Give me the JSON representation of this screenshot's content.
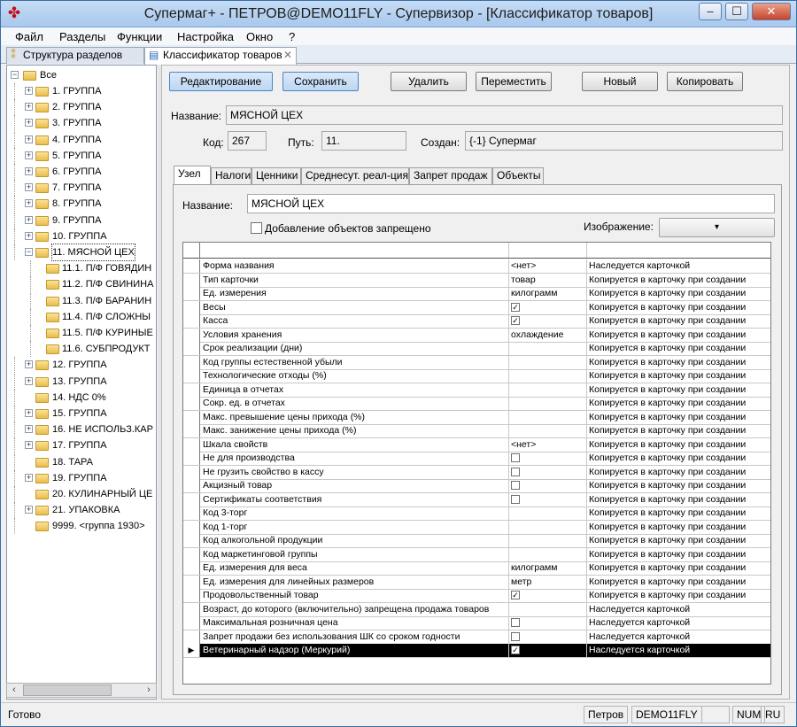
{
  "window": {
    "title": "Супермаг+ - ПЕТРОВ@DEMO11FLY - Супервизор  - [Классификатор товаров]",
    "buttons": {
      "minimize": "–",
      "maximize": "☐",
      "close": "✕"
    }
  },
  "menu": [
    "Файл",
    "Разделы",
    "Функции",
    "Настройка",
    "Окно",
    "?"
  ],
  "doc_tabs": [
    {
      "label": "Структура разделов",
      "active": false
    },
    {
      "label": "Классификатор товаров",
      "active": true
    }
  ],
  "tree": {
    "root": "Все",
    "items": [
      {
        "label": "1. ГРУППА",
        "level": 1,
        "expander": "+"
      },
      {
        "label": "2. ГРУППА",
        "level": 1,
        "expander": "+"
      },
      {
        "label": "3. ГРУППА",
        "level": 1,
        "expander": "+"
      },
      {
        "label": "4. ГРУППА",
        "level": 1,
        "expander": "+"
      },
      {
        "label": "5. ГРУППА",
        "level": 1,
        "expander": "+"
      },
      {
        "label": "6. ГРУППА",
        "level": 1,
        "expander": "+"
      },
      {
        "label": "7. ГРУППА",
        "level": 1,
        "expander": "+"
      },
      {
        "label": "8. ГРУППА",
        "level": 1,
        "expander": "+"
      },
      {
        "label": "9. ГРУППА",
        "level": 1,
        "expander": "+"
      },
      {
        "label": "10. ГРУППА",
        "level": 1,
        "expander": "+"
      },
      {
        "label": "11. МЯСНОЙ ЦЕХ",
        "level": 1,
        "expander": "−",
        "selected": true
      },
      {
        "label": "11.1. П/Ф ГОВЯДИН",
        "level": 2,
        "expander": ""
      },
      {
        "label": "11.2. П/Ф СВИНИНА",
        "level": 2,
        "expander": ""
      },
      {
        "label": "11.3. П/Ф БАРАНИН",
        "level": 2,
        "expander": ""
      },
      {
        "label": "11.4. П/Ф СЛОЖНЫ",
        "level": 2,
        "expander": ""
      },
      {
        "label": "11.5. П/Ф КУРИНЫЕ",
        "level": 2,
        "expander": ""
      },
      {
        "label": "11.6. СУБПРОДУКТ",
        "level": 2,
        "expander": ""
      },
      {
        "label": "12. ГРУППА",
        "level": 1,
        "expander": "+"
      },
      {
        "label": "13. ГРУППА",
        "level": 1,
        "expander": "+"
      },
      {
        "label": "14. НДС 0%",
        "level": 1,
        "expander": ""
      },
      {
        "label": "15. ГРУППА",
        "level": 1,
        "expander": "+"
      },
      {
        "label": "16. НЕ ИСПОЛЬЗ.КАР",
        "level": 1,
        "expander": "+"
      },
      {
        "label": "17. ГРУППА",
        "level": 1,
        "expander": "+"
      },
      {
        "label": "18. ТАРА",
        "level": 1,
        "expander": ""
      },
      {
        "label": "19. ГРУППА",
        "level": 1,
        "expander": "+"
      },
      {
        "label": "20. КУЛИНАРНЫЙ ЦЕ",
        "level": 1,
        "expander": ""
      },
      {
        "label": "21. УПАКОВКА",
        "level": 1,
        "expander": "+"
      },
      {
        "label": "9999. <группа 1930>",
        "level": 1,
        "expander": ""
      }
    ]
  },
  "toolbar": {
    "edit": "Редактирование",
    "save": "Сохранить",
    "delete": "Удалить",
    "move": "Переместить",
    "new": "Новый",
    "copy": "Копировать"
  },
  "header": {
    "name_label": "Название:",
    "name_value": "МЯСНОЙ ЦЕХ",
    "code_label": "Код:",
    "code_value": "267",
    "path_label": "Путь:",
    "path_value": "11.",
    "created_label": "Создан:",
    "created_value": "{-1} Супермаг"
  },
  "inner_tabs": [
    "Узел",
    "Налоги",
    "Ценники",
    "Среднесут. реал-ция",
    "Запрет продаж",
    "Объекты"
  ],
  "node_panel": {
    "name_label": "Название:",
    "name_value": "МЯСНОЙ ЦЕХ",
    "forbid_label": "Добавление объектов запрещено",
    "image_label": "Изображение:",
    "image_value": "▾"
  },
  "grid_rows": [
    {
      "name": "Форма названия",
      "value": "<нет>",
      "mode": "Наследуется карточкой"
    },
    {
      "name": "Тип карточки",
      "value": "товар",
      "mode": "Копируется в карточку при создании"
    },
    {
      "name": "Ед. измерения",
      "value": "килограмм",
      "mode": "Копируется в карточку при создании"
    },
    {
      "name": "Весы",
      "value": "",
      "check": "✓",
      "mode": "Копируется в карточку при создании"
    },
    {
      "name": "Касса",
      "value": "",
      "check": "✓",
      "mode": "Копируется в карточку при создании"
    },
    {
      "name": "Условия хранения",
      "value": "охлаждение",
      "mode": "Копируется в карточку при создании"
    },
    {
      "name": "Срок реализации (дни)",
      "value": "",
      "mode": "Копируется в карточку при создании"
    },
    {
      "name": "Код группы естественной убыли",
      "value": "",
      "mode": "Копируется в карточку при создании"
    },
    {
      "name": "Технологические отходы (%)",
      "value": "",
      "mode": "Копируется в карточку при создании"
    },
    {
      "name": "Единица в отчетах",
      "value": "",
      "mode": "Копируется в карточку при создании"
    },
    {
      "name": "Сокр. ед. в отчетах",
      "value": "",
      "mode": "Копируется в карточку при создании"
    },
    {
      "name": "Макс. превышение цены прихода (%)",
      "value": "",
      "mode": "Копируется в карточку при создании"
    },
    {
      "name": "Макс. занижение цены прихода (%)",
      "value": "",
      "mode": "Копируется в карточку при создании"
    },
    {
      "name": "Шкала свойств",
      "value": "<нет>",
      "mode": "Копируется в карточку при создании"
    },
    {
      "name": "Не для производства",
      "value": "",
      "check": "",
      "mode": "Копируется в карточку при создании"
    },
    {
      "name": "Не грузить свойство в кассу",
      "value": "",
      "check": "",
      "mode": "Копируется в карточку при создании"
    },
    {
      "name": "Акцизный товар",
      "value": "",
      "check": "",
      "mode": "Копируется в карточку при создании"
    },
    {
      "name": "Сертификаты соответствия",
      "value": "",
      "check": "",
      "mode": "Копируется в карточку при создании"
    },
    {
      "name": "Код 3-торг",
      "value": "",
      "mode": "Копируется в карточку при создании"
    },
    {
      "name": "Код 1-торг",
      "value": "",
      "mode": "Копируется в карточку при создании"
    },
    {
      "name": "Код алкогольной продукции",
      "value": "",
      "mode": "Копируется в карточку при создании"
    },
    {
      "name": "Код маркетинговой группы",
      "value": "",
      "mode": "Копируется в карточку при создании"
    },
    {
      "name": "Ед. измерения для веса",
      "value": "килограмм",
      "mode": "Копируется в карточку при создании"
    },
    {
      "name": "Ед. измерения для линейных размеров",
      "value": "метр",
      "mode": "Копируется в карточку при создании"
    },
    {
      "name": "Продовольственный товар",
      "value": "",
      "check": "✓",
      "mode": "Копируется в карточку при создании"
    },
    {
      "name": "Возраст, до которого (включительно) запрещена продажа товаров",
      "value": "",
      "mode": "Наследуется карточкой"
    },
    {
      "name": "Максимальная розничная цена",
      "value": "",
      "check": "",
      "mode": "Наследуется карточкой"
    },
    {
      "name": "Запрет продажи без использования ШК со сроком годности",
      "value": "",
      "check": "",
      "mode": "Наследуется карточкой"
    },
    {
      "name": "Ветеринарный надзор (Меркурий)",
      "value": "",
      "check": "✓",
      "mode": "Наследуется карточкой",
      "selected": true
    }
  ],
  "status": {
    "ready": "Готово",
    "user": "Петров",
    "db": "DEMO11FLY",
    "num": "NUM",
    "lang": "RU"
  }
}
